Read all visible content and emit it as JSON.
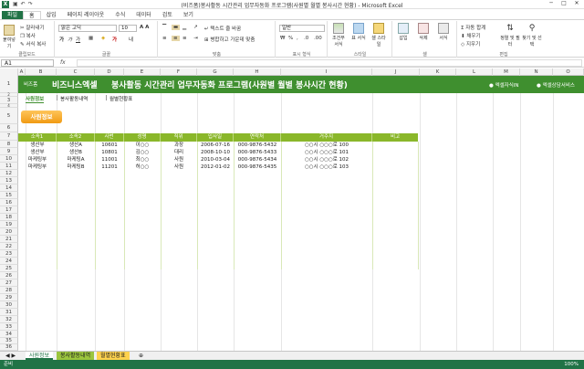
{
  "window": {
    "title": "(비즈폼)봉사활동 시간관리 업무자동화 프로그램(사원별 월별 봉사시간 현황) - Microsoft Excel",
    "controls": [
      "─",
      "□",
      "✕"
    ]
  },
  "ribbon_tabs": [
    "파일",
    "홈",
    "삽입",
    "페이지 레이아웃",
    "수식",
    "데이터",
    "검토",
    "보기"
  ],
  "ribbon": {
    "clipboard": {
      "paste": "붙여넣기",
      "cut": "잘라내기",
      "copy": "복사",
      "format_painter": "서식 복사",
      "label": "클립보드"
    },
    "font": {
      "name": "맑은 고딕",
      "size": "10",
      "label": "글꼴"
    },
    "align": {
      "wrap": "텍스트 줄 바꿈",
      "merge": "병합하고 가운데 맞춤",
      "label": "맞춤"
    },
    "number": {
      "format": "일반",
      "label": "표시 형식"
    },
    "styles": {
      "cond": "조건부 서식",
      "table": "표 서식",
      "cell": "셀 스타일",
      "label": "스타일"
    },
    "cells": {
      "insert": "삽입",
      "delete": "삭제",
      "format": "서식",
      "label": "셀"
    },
    "editing": {
      "autosum": "자동 합계",
      "fill": "채우기",
      "clear": "지우기",
      "sort": "정렬 및 필터",
      "find": "찾기 및 선택",
      "label": "편집"
    }
  },
  "formula_bar": {
    "name_box": "A1",
    "fx": "fx",
    "value": ""
  },
  "columns": [
    "A",
    "B",
    "C",
    "D",
    "E",
    "F",
    "G",
    "H",
    "I",
    "J",
    "K",
    "L",
    "M",
    "N",
    "O"
  ],
  "rows": [
    "1",
    "2",
    "3",
    "4",
    "5",
    "6",
    "7",
    "8",
    "9",
    "10",
    "11",
    "12",
    "13",
    "14",
    "15",
    "16",
    "17",
    "18",
    "19",
    "20",
    "21",
    "22",
    "23",
    "24",
    "25",
    "26",
    "27",
    "28",
    "29",
    "30",
    "31",
    "32",
    "33",
    "34",
    "35",
    "36",
    "37",
    "38",
    "39",
    "40"
  ],
  "banner": {
    "brand_small": "비즈폼",
    "brand": "비즈니스엑셀",
    "title": "봉사활동 시간관리 업무자동화 프로그램(사원별 월별 봉사시간 현황)",
    "link1": "엑셀자식IN",
    "link2": "엑셀상담서비스"
  },
  "nav": [
    "사원정보",
    "봉사활동내역",
    "월별현황표"
  ],
  "section_button": "사원정보",
  "table": {
    "headers": [
      "소속1",
      "소속2",
      "사번",
      "성명",
      "직위",
      "입사일",
      "연락처",
      "거주지",
      "비고"
    ],
    "rows": [
      [
        "생산부",
        "생산A",
        "10601",
        "이○○",
        "과장",
        "2006-07-16",
        "000-9876-5432",
        "○○시 ○○○로 100",
        ""
      ],
      [
        "생산부",
        "생산B",
        "10801",
        "김○○",
        "대리",
        "2008-10-10",
        "000-9876-5433",
        "○○시 ○○○로 101",
        ""
      ],
      [
        "마케팅부",
        "마케팅A",
        "11001",
        "최○○",
        "사원",
        "2010-03-04",
        "000-9876-5434",
        "○○시 ○○○로 102",
        ""
      ],
      [
        "마케팅부",
        "마케팅B",
        "11201",
        "허○○",
        "사원",
        "2012-01-02",
        "000-9876-5435",
        "○○시 ○○○로 103",
        ""
      ]
    ]
  },
  "sheet_tabs": [
    "사원정보",
    "봉사활동내역",
    "월별현황표"
  ],
  "status": {
    "ready": "준비",
    "zoom": "100%"
  }
}
